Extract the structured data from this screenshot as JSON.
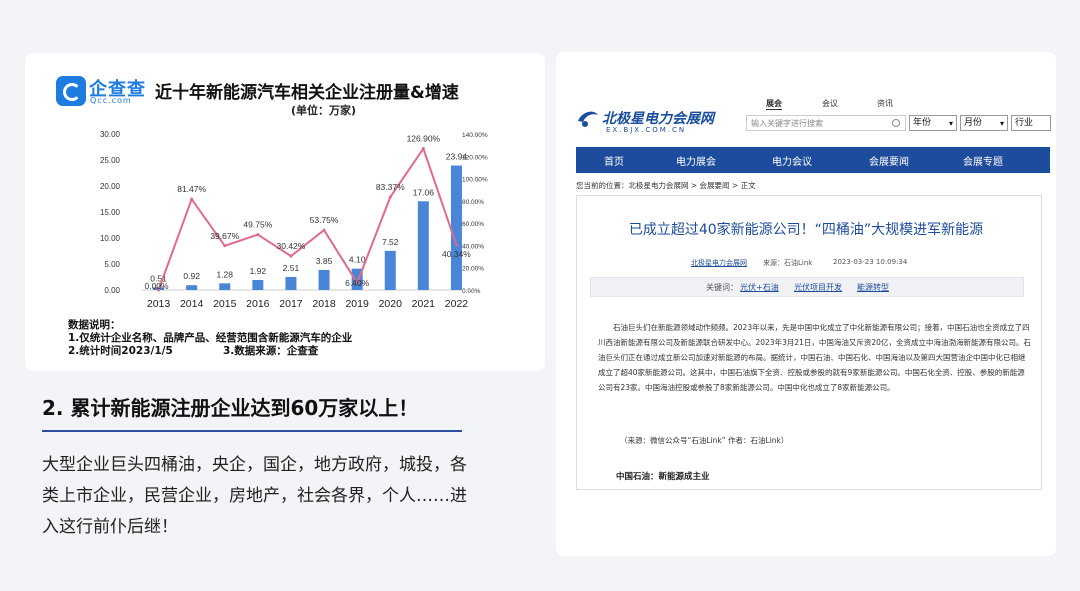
{
  "left_card": {
    "logo_name": "企查查",
    "logo_url": "Qcc.com",
    "chart_title": "近十年新能源汽车相关企业注册量&增速",
    "chart_unit": "(单位：万家)",
    "notes": {
      "heading": "数据说明：",
      "item1": "1.仅统计企业名称、品牌产品、经营范围含新能源汽车的企业",
      "item2": "2.统计时间2023/1/5",
      "item3": "3.数据来源：企查查"
    }
  },
  "chart_data": {
    "type": "bar",
    "categories": [
      "2013",
      "2014",
      "2015",
      "2016",
      "2017",
      "2018",
      "2019",
      "2020",
      "2021",
      "2022"
    ],
    "series": [
      {
        "values": [
          0.51,
          0.92,
          1.28,
          1.92,
          2.51,
          3.85,
          4.1,
          7.52,
          17.06,
          23.94
        ],
        "labels": [
          "0.51",
          "0.92",
          "1.28",
          "1.92",
          "2.51",
          "3.85",
          "4.10",
          "7.52",
          "17.06",
          "23.94"
        ],
        "color": "#4a86d8"
      },
      {
        "values": [
          0.0,
          81.47,
          39.67,
          49.75,
          30.42,
          53.75,
          6.4,
          83.37,
          126.9,
          40.34
        ],
        "labels": [
          "0.00%",
          "81.47%",
          "39.67%",
          "49.75%",
          "30.42%",
          "53.75%",
          "6.40%",
          "83.37%",
          "126.90%",
          "40.34%"
        ],
        "color": "#e06a8a"
      }
    ],
    "y_left_ticks": [
      "30.00",
      "25.00",
      "20.00",
      "15.00",
      "10.00",
      "5.00",
      "0.00"
    ],
    "y_right_ticks": [
      "140.00%",
      "120.00%",
      "100.00%",
      "80.00%",
      "60.00%",
      "40.00%",
      "20.00%",
      "0.00%"
    ],
    "ylim_left": [
      0,
      30
    ],
    "ylim_right": [
      0,
      140
    ],
    "grid": false
  },
  "section": {
    "title": "2. 累计新能源注册企业达到60万家以上！",
    "body": "大型企业巨头四桶油，央企，国企，地方政府，城投，各类上市企业，民营企业，房地产，社会各界，个人……进入这行前仆后继！"
  },
  "right_card": {
    "site_name": "北极星电力会展网",
    "site_url": "EX.BJX.COM.CN",
    "top_nav": [
      "展会",
      "会议",
      "资讯"
    ],
    "search_placeholder": "输入关键字进行搜索",
    "selects": [
      "年份",
      "月份",
      "行业"
    ],
    "nav": [
      "首页",
      "电力展会",
      "电力会议",
      "会展要闻",
      "会展专题"
    ],
    "breadcrumb": "您当前的位置：北极星电力会展网 > 会展要闻 > 正文",
    "article_title": "已成立超过40家新能源公司！“四桶油”大规模进军新能源",
    "meta_source_site": "北极星电力会展网",
    "meta_from": "来源：石油Link",
    "meta_time": "2023-03-23 10:09:34",
    "kw_label": "关键词：",
    "keywords": [
      "光伏+石油",
      "光伏项目开发",
      "能源转型"
    ],
    "paragraph": "石油巨头们在新能源领域动作频频。2023年以来，先是中国中化成立了中化新能源有限公司；接着，中国石油也全资成立了四川西油新能源有限公司及新能源联合研发中心。2023年3月21日，中国海油又斥资20亿，全资成立中海油渤海新能源有限公司。石油巨头们正在通过成立新公司加速对新能源的布局。据统计，中国石油、中国石化、中国海油以及第四大国营油企中国中化已相继成立了超40家新能源公司。这其中，中国石油旗下全资、控股或参股的就有9家新能源公司。中国石化全资、控股、参股的新能源公司有23家。中国海油控股或参股了8家新能源公司。中国中化也成立了8家新能源公司。",
    "source_line": "（来源：微信公众号“石油Link” 作者：石油Link）",
    "subhead": "中国石油：新能源成主业"
  }
}
